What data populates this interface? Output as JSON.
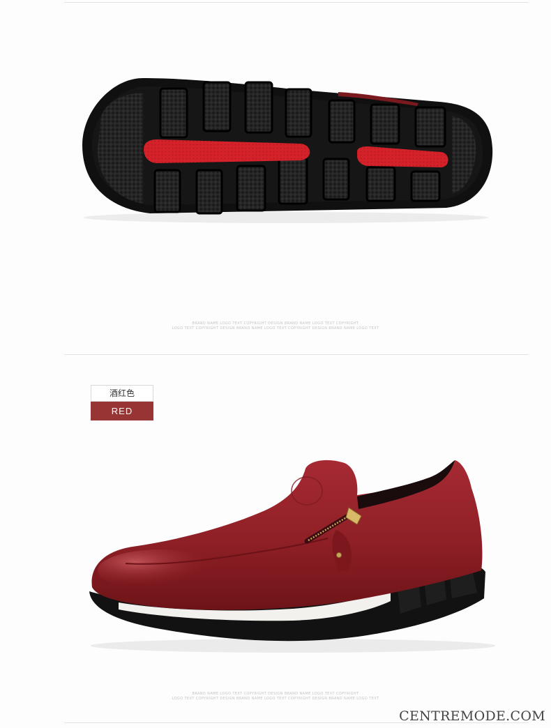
{
  "product": {
    "color_name_cn": "酒红色",
    "color_name_en": "RED",
    "colors": {
      "leather": "#8e1f26",
      "sole_rubber": "#141414",
      "sole_insert": "#d5222a",
      "midsole": "#f3f1ee",
      "tag": "#973535"
    }
  },
  "images": {
    "sole": {
      "name": "shoe-sole-bottom-view"
    },
    "shoe": {
      "name": "shoe-side-view"
    }
  },
  "fine_print": {
    "top_line1": "BRAND NAME LOGO TEXT COPYRIGHT DESIGN BRAND NAME LOGO TEXT COPYRIGHT",
    "top_line2": "LOGO TEXT COPYRIGHT DESIGN BRAND NAME LOGO TEXT COPYRIGHT DESIGN BRAND NAME LOGO TEXT",
    "bottom_line1": "BRAND NAME LOGO TEXT COPYRIGHT DESIGN BRAND NAME LOGO TEXT COPYRIGHT",
    "bottom_line2": "LOGO TEXT COPYRIGHT DESIGN BRAND NAME LOGO TEXT COPYRIGHT DESIGN BRAND NAME LOGO TEXT"
  },
  "watermark": "CENTREMODE.COM"
}
